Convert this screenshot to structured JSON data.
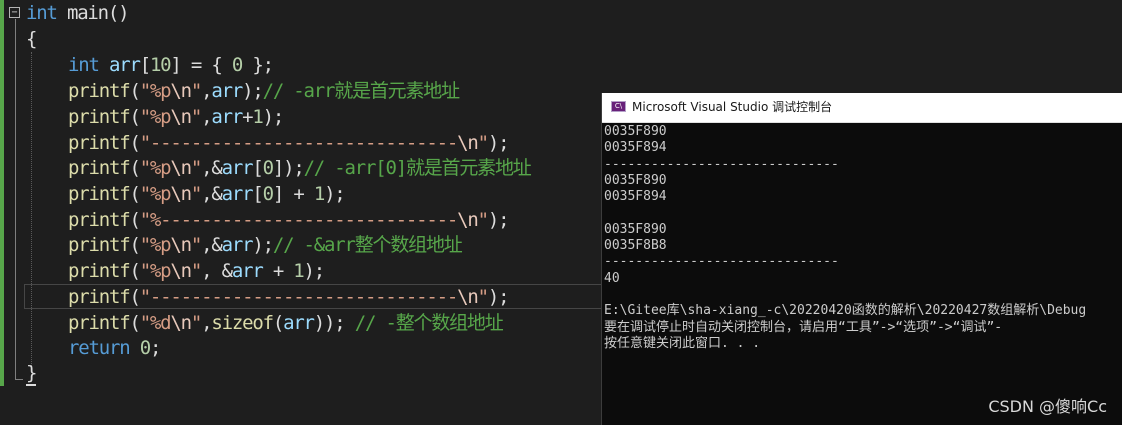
{
  "editor": {
    "lines": [
      [
        {
          "c": "kw",
          "t": "int"
        },
        {
          "c": "plain",
          "t": " main()"
        }
      ],
      [
        {
          "c": "plain",
          "t": "{"
        }
      ],
      [
        {
          "c": "plain",
          "t": ""
        }
      ],
      [
        {
          "c": "kw",
          "t": "int"
        },
        {
          "c": "plain",
          "t": " "
        },
        {
          "c": "var",
          "t": "arr"
        },
        {
          "c": "plain",
          "t": "["
        },
        {
          "c": "num",
          "t": "10"
        },
        {
          "c": "plain",
          "t": "] = { "
        },
        {
          "c": "num",
          "t": "0"
        },
        {
          "c": "plain",
          "t": " };"
        }
      ],
      [
        {
          "c": "fn",
          "t": "printf"
        },
        {
          "c": "plain",
          "t": "("
        },
        {
          "c": "str",
          "t": "\"%p"
        },
        {
          "c": "esc",
          "t": "\\n"
        },
        {
          "c": "str",
          "t": "\""
        },
        {
          "c": "plain",
          "t": ","
        },
        {
          "c": "var",
          "t": "arr"
        },
        {
          "c": "plain",
          "t": ");"
        },
        {
          "c": "cmt",
          "t": "// -arr就是首元素地址"
        }
      ],
      [
        {
          "c": "fn",
          "t": "printf"
        },
        {
          "c": "plain",
          "t": "("
        },
        {
          "c": "str",
          "t": "\"%p"
        },
        {
          "c": "esc",
          "t": "\\n"
        },
        {
          "c": "str",
          "t": "\""
        },
        {
          "c": "plain",
          "t": ","
        },
        {
          "c": "var",
          "t": "arr"
        },
        {
          "c": "plain",
          "t": "+"
        },
        {
          "c": "num",
          "t": "1"
        },
        {
          "c": "plain",
          "t": ");"
        }
      ],
      [
        {
          "c": "fn",
          "t": "printf"
        },
        {
          "c": "plain",
          "t": "("
        },
        {
          "c": "str",
          "t": "\"------------------------------"
        },
        {
          "c": "esc",
          "t": "\\n"
        },
        {
          "c": "str",
          "t": "\""
        },
        {
          "c": "plain",
          "t": ");"
        }
      ],
      [
        {
          "c": "fn",
          "t": "printf"
        },
        {
          "c": "plain",
          "t": "("
        },
        {
          "c": "str",
          "t": "\"%p"
        },
        {
          "c": "esc",
          "t": "\\n"
        },
        {
          "c": "str",
          "t": "\""
        },
        {
          "c": "plain",
          "t": ",&"
        },
        {
          "c": "var",
          "t": "arr"
        },
        {
          "c": "plain",
          "t": "["
        },
        {
          "c": "num",
          "t": "0"
        },
        {
          "c": "plain",
          "t": "]);"
        },
        {
          "c": "cmt",
          "t": "// -arr[0]就是首元素地址"
        }
      ],
      [
        {
          "c": "fn",
          "t": "printf"
        },
        {
          "c": "plain",
          "t": "("
        },
        {
          "c": "str",
          "t": "\"%p"
        },
        {
          "c": "esc",
          "t": "\\n"
        },
        {
          "c": "str",
          "t": "\""
        },
        {
          "c": "plain",
          "t": ",&"
        },
        {
          "c": "var",
          "t": "arr"
        },
        {
          "c": "plain",
          "t": "["
        },
        {
          "c": "num",
          "t": "0"
        },
        {
          "c": "plain",
          "t": "] + "
        },
        {
          "c": "num",
          "t": "1"
        },
        {
          "c": "plain",
          "t": ");"
        }
      ],
      [
        {
          "c": "fn",
          "t": "printf"
        },
        {
          "c": "plain",
          "t": "("
        },
        {
          "c": "str",
          "t": "\"%-----------------------------"
        },
        {
          "c": "esc",
          "t": "\\n"
        },
        {
          "c": "str",
          "t": "\""
        },
        {
          "c": "plain",
          "t": ");"
        }
      ],
      [
        {
          "c": "fn",
          "t": "printf"
        },
        {
          "c": "plain",
          "t": "("
        },
        {
          "c": "str",
          "t": "\"%p"
        },
        {
          "c": "esc",
          "t": "\\n"
        },
        {
          "c": "str",
          "t": "\""
        },
        {
          "c": "plain",
          "t": ",&"
        },
        {
          "c": "var",
          "t": "arr"
        },
        {
          "c": "plain",
          "t": ");"
        },
        {
          "c": "cmt",
          "t": "// -&arr整个数组地址"
        }
      ],
      [
        {
          "c": "fn",
          "t": "printf"
        },
        {
          "c": "plain",
          "t": "("
        },
        {
          "c": "str",
          "t": "\"%p"
        },
        {
          "c": "esc",
          "t": "\\n"
        },
        {
          "c": "str",
          "t": "\""
        },
        {
          "c": "plain",
          "t": ", &"
        },
        {
          "c": "var",
          "t": "arr"
        },
        {
          "c": "plain",
          "t": " + "
        },
        {
          "c": "num",
          "t": "1"
        },
        {
          "c": "plain",
          "t": ");"
        }
      ],
      [
        {
          "c": "fn",
          "t": "printf"
        },
        {
          "c": "plain",
          "t": "("
        },
        {
          "c": "str",
          "t": "\"------------------------------"
        },
        {
          "c": "esc",
          "t": "\\n"
        },
        {
          "c": "str",
          "t": "\""
        },
        {
          "c": "plain",
          "t": ");"
        }
      ],
      [
        {
          "c": "fn",
          "t": "printf"
        },
        {
          "c": "plain",
          "t": "("
        },
        {
          "c": "str",
          "t": "\"%d"
        },
        {
          "c": "esc",
          "t": "\\n"
        },
        {
          "c": "str",
          "t": "\""
        },
        {
          "c": "plain",
          "t": ","
        },
        {
          "c": "fn",
          "t": "sizeof"
        },
        {
          "c": "plain",
          "t": "("
        },
        {
          "c": "var",
          "t": "arr"
        },
        {
          "c": "plain",
          "t": ")); "
        },
        {
          "c": "cmt",
          "t": "// -整个数组地址"
        }
      ],
      [
        {
          "c": "kw",
          "t": "return"
        },
        {
          "c": "plain",
          "t": " "
        },
        {
          "c": "num",
          "t": "0"
        },
        {
          "c": "plain",
          "t": ";"
        }
      ],
      [
        {
          "c": "plain",
          "t": "}"
        }
      ]
    ]
  },
  "console": {
    "title": "Microsoft Visual Studio 调试控制台",
    "icon_text": "C\\",
    "output": [
      "0035F890",
      "0035F894",
      "------------------------------",
      "0035F890",
      "0035F894",
      "",
      "0035F890",
      "0035F8B8",
      "------------------------------",
      "40",
      "",
      "E:\\Gitee库\\sha-xiang_-c\\20220420函数的解析\\20220427数组解析\\Debug",
      "要在调试停止时自动关闭控制台，请启用“工具”->“选项”->“调试”-",
      "按任意键关闭此窗口. . ."
    ]
  },
  "watermark": "CSDN @傻响Cc",
  "colors": {
    "keyword": "#569cd6",
    "string": "#d69d85",
    "function": "#dcdcaa",
    "variable": "#9cdcfe",
    "number": "#b5cea8",
    "comment": "#57a64a",
    "editor_bg": "#1e1e1e",
    "console_bg": "#0c0c0c"
  },
  "icons": {
    "fold": "collapse-minus-icon",
    "console_app": "visual-studio-console-icon"
  }
}
